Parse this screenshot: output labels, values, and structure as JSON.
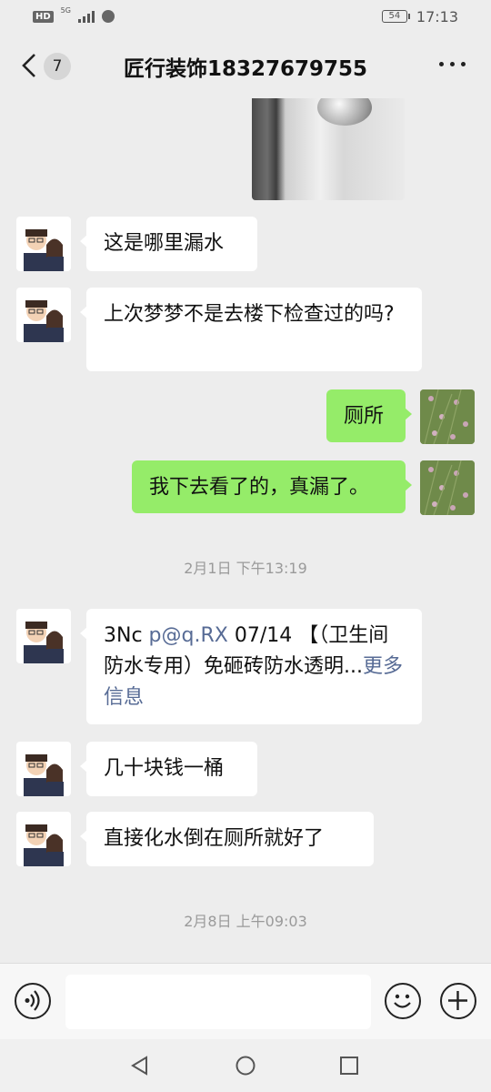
{
  "status_bar": {
    "hd": "HD",
    "net": "5G",
    "battery": "54",
    "time": "17:13"
  },
  "header": {
    "unread_count": "7",
    "title": "匠行装饰18327679755"
  },
  "messages": [
    {
      "text": "这是哪里漏水"
    },
    {
      "text": "上次梦梦不是去楼下检查过的吗?"
    },
    {
      "text": "厕所"
    },
    {
      "text": "我下去看了的，真漏了。"
    },
    {
      "text": "几十块钱一桶"
    },
    {
      "text": "直接化水倒在厕所就好了"
    }
  ],
  "link_message": {
    "prefix": "3Nc ",
    "link": "p@q.RX",
    "rest": " 07/14 【（卫生间防水专用）免砸砖防水透明...",
    "more": "更多信息"
  },
  "timestamps": [
    "2月1日 下午13:19",
    "2月8日 上午09:03"
  ],
  "icons": {
    "back": "chevron-left-icon",
    "more": "more-dots-icon",
    "voice": "voice-icon",
    "emoji": "emoji-icon",
    "plus": "plus-icon",
    "nav": [
      "back-triangle-icon",
      "home-circle-icon",
      "recent-square-icon"
    ]
  },
  "colors": {
    "outgoing_bubble": "#95ec69",
    "link": "#576b95",
    "background": "#ededed"
  }
}
